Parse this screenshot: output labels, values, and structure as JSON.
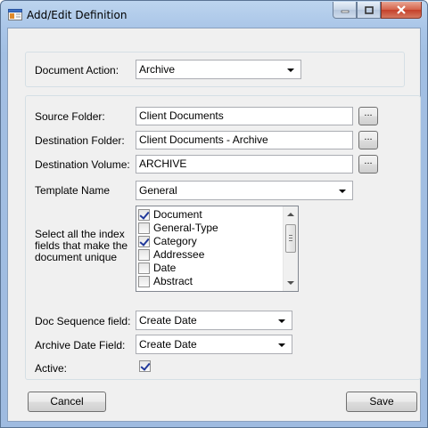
{
  "window": {
    "title": "Add/Edit Definition"
  },
  "document_action": {
    "label": "Document Action:",
    "value": "Archive"
  },
  "source_folder": {
    "label": "Source Folder:",
    "value": "Client Documents",
    "browse": "..."
  },
  "destination_folder": {
    "label": "Destination Folder:",
    "value": "Client Documents - Archive",
    "browse": "..."
  },
  "destination_volume": {
    "label": "Destination Volume:",
    "value": "ARCHIVE",
    "browse": "..."
  },
  "template_name": {
    "label": "Template Name",
    "value": "General"
  },
  "index_fields": {
    "label": "Select all the index fields that make the document unique",
    "items": [
      {
        "label": "Document",
        "checked": true
      },
      {
        "label": "General-Type",
        "checked": false
      },
      {
        "label": "Category",
        "checked": true
      },
      {
        "label": "Addressee",
        "checked": false
      },
      {
        "label": "Date",
        "checked": false
      },
      {
        "label": "Abstract",
        "checked": false
      }
    ]
  },
  "doc_sequence": {
    "label": "Doc Sequence field:",
    "value": "Create Date"
  },
  "archive_date": {
    "label": "Archive Date Field:",
    "value": "Create Date"
  },
  "active": {
    "label": "Active:",
    "checked": true
  },
  "buttons": {
    "cancel": "Cancel",
    "save": "Save"
  }
}
